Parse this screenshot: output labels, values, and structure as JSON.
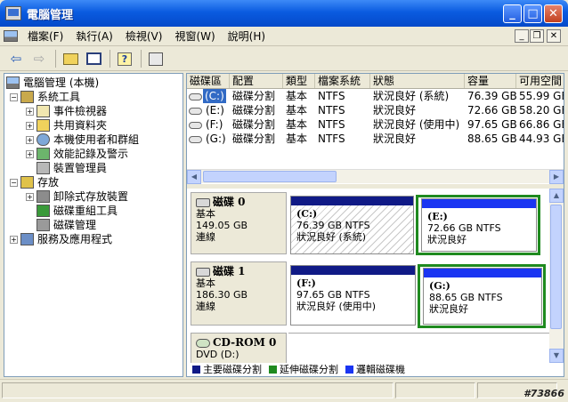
{
  "window": {
    "title": "電腦管理",
    "min": "_",
    "max": "□",
    "close": "✕"
  },
  "menu": [
    {
      "label": "檔案(F)"
    },
    {
      "label": "執行(A)"
    },
    {
      "label": "檢視(V)"
    },
    {
      "label": "視窗(W)"
    },
    {
      "label": "說明(H)"
    }
  ],
  "mdi": {
    "min": "_",
    "restore": "❐",
    "close": "✕"
  },
  "tree": {
    "root": "電腦管理 (本機)",
    "system_tools": "系統工具",
    "event_viewer": "事件檢視器",
    "shared_folders": "共用資料夾",
    "local_users": "本機使用者和群組",
    "perf_logs": "效能記錄及警示",
    "device_manager": "裝置管理員",
    "storage": "存放",
    "removable": "卸除式存放裝置",
    "defrag": "磁碟重組工具",
    "disk_mgmt": "磁碟管理",
    "services": "服務及應用程式"
  },
  "volumes": {
    "headers": [
      "磁碟區",
      "配置",
      "類型",
      "檔案系統",
      "狀態",
      "容量",
      "可用空間"
    ],
    "rows": [
      {
        "vol": "(C:)",
        "layout": "磁碟分割",
        "type": "基本",
        "fs": "NTFS",
        "status": "狀況良好 (系統)",
        "cap": "76.39 GB",
        "free": "55.99 GB"
      },
      {
        "vol": "(E:)",
        "layout": "磁碟分割",
        "type": "基本",
        "fs": "NTFS",
        "status": "狀況良好",
        "cap": "72.66 GB",
        "free": "58.20 GB"
      },
      {
        "vol": "(F:)",
        "layout": "磁碟分割",
        "type": "基本",
        "fs": "NTFS",
        "status": "狀況良好 (使用中)",
        "cap": "97.65 GB",
        "free": "66.86 GB"
      },
      {
        "vol": "(G:)",
        "layout": "磁碟分割",
        "type": "基本",
        "fs": "NTFS",
        "status": "狀況良好",
        "cap": "88.65 GB",
        "free": "44.93 GB"
      }
    ]
  },
  "disks": [
    {
      "name": "磁碟 0",
      "type": "基本",
      "size": "149.05 GB",
      "state": "連線",
      "parts": [
        {
          "label": "(C:)",
          "size": "76.39 GB NTFS",
          "status": "狀況良好 (系統)"
        },
        {
          "label": "(E:)",
          "size": "72.66 GB NTFS",
          "status": "狀況良好"
        }
      ]
    },
    {
      "name": "磁碟 1",
      "type": "基本",
      "size": "186.30 GB",
      "state": "連線",
      "parts": [
        {
          "label": "(F:)",
          "size": "97.65 GB NTFS",
          "status": "狀況良好 (使用中)"
        },
        {
          "label": "(G:)",
          "size": "88.65 GB NTFS",
          "status": "狀況良好"
        }
      ]
    }
  ],
  "cdrom": {
    "name": "CD-ROM 0",
    "type": "DVD (D:)"
  },
  "legend": [
    {
      "label": "主要磁碟分割",
      "color": "#101a86"
    },
    {
      "label": "延伸磁碟分割",
      "color": "#1f8a1f"
    },
    {
      "label": "邏輯磁碟機",
      "color": "#1a35f2"
    }
  ],
  "watermark": "#73866"
}
